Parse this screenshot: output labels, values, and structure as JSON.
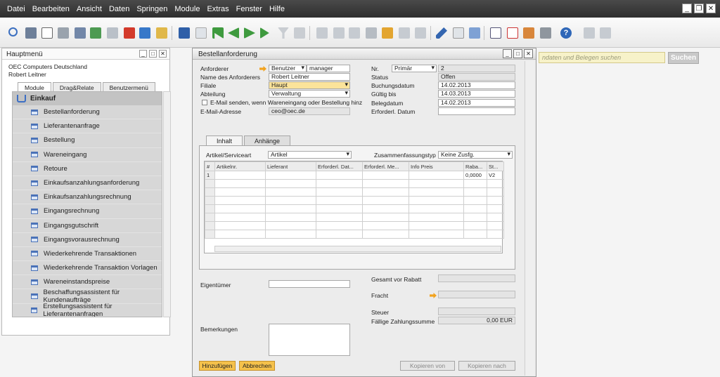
{
  "menubar": {
    "items": [
      "Datei",
      "Bearbeiten",
      "Ansicht",
      "Daten",
      "Springen",
      "Module",
      "Extras",
      "Fenster",
      "Hilfe"
    ]
  },
  "search": {
    "placeholder": "ndaten und Belegen suchen",
    "button": "Suchen"
  },
  "mainmenu": {
    "title": "Hauptmenü",
    "company": "OEC Computers Deutschland",
    "user": "Robert Leitner",
    "tabs": [
      "Module",
      "Drag&Relate",
      "Benutzermenü"
    ],
    "group": "Einkauf",
    "items": [
      "Bestellanforderung",
      "Lieferantenanfrage",
      "Bestellung",
      "Wareneingang",
      "Retoure",
      "Einkaufsanzahlungsanforderung",
      "Einkaufsanzahlungsrechnung",
      "Eingangsrechnung",
      "Eingangsgutschrift",
      "Eingangsvorausrechnung",
      "Wiederkehrende Transaktionen",
      "Wiederkehrende Transaktion Vorlagen",
      "Wareneinstandspreise",
      "Beschaffungsassistent für Kundenaufträge",
      "Erstellungsassistent für Lieferantenanfragen"
    ]
  },
  "form": {
    "title": "Bestellanforderung",
    "left": {
      "anforderer_label": "Anforderer",
      "anforderer_type": "Benutzer",
      "anforderer_value": "manager",
      "name_label": "Name des Anforderers",
      "name_value": "Robert Leitner",
      "filiale_label": "Filiale",
      "filiale_value": "Haupt",
      "abteilung_label": "Abteilung",
      "abteilung_value": "Verwaltung",
      "email_check_label": "E-Mail senden, wenn Wareneingang oder Bestellung hinz",
      "email_label": "E-Mail-Adresse",
      "email_value": "ceo@oec.de"
    },
    "right": {
      "nr_label": "Nr.",
      "nr_series": "Primär",
      "nr_value": "2",
      "status_label": "Status",
      "status_value": "Offen",
      "buchung_label": "Buchungsdatum",
      "buchung_value": "14.02.2013",
      "gueltig_label": "Gültig bis",
      "gueltig_value": "14.03.2013",
      "beleg_label": "Belegdatum",
      "beleg_value": "14.02.2013",
      "erforderl_label": "Erforderl. Datum",
      "erforderl_value": ""
    },
    "tabs": [
      "Inhalt",
      "Anhänge"
    ],
    "artikel_label": "Artikel/Serviceart",
    "artikel_value": "Artikel",
    "zusammen_label": "Zusammenfassungstyp",
    "zusammen_value": "Keine Zusfg.",
    "grid": {
      "columns": [
        "#",
        "Artikelnr.",
        "Lieferant",
        "Erforderl. Dat...",
        "Erforderl. Me...",
        "Info Preis",
        "Raba...",
        "St..."
      ],
      "row1": [
        "1",
        "",
        "",
        "",
        "",
        "",
        "0,0000",
        "V2"
      ]
    },
    "bottom": {
      "eigentuemer_label": "Eigentümer",
      "bemerkungen_label": "Bemerkungen",
      "gesamt_label": "Gesamt vor Rabatt",
      "fracht_label": "Fracht",
      "steuer_label": "Steuer",
      "faellig_label": "Fällige Zahlungssumme",
      "faellig_value": "0,00 EUR"
    },
    "buttons": {
      "add": "Hinzufügen",
      "cancel": "Abbrechen",
      "copy_from": "Kopieren von",
      "copy_to": "Kopieren nach"
    }
  },
  "colors": {
    "accent": "#f5c14b",
    "menubar": "#3a3a3a",
    "link_arrow": "#f2a31f"
  }
}
